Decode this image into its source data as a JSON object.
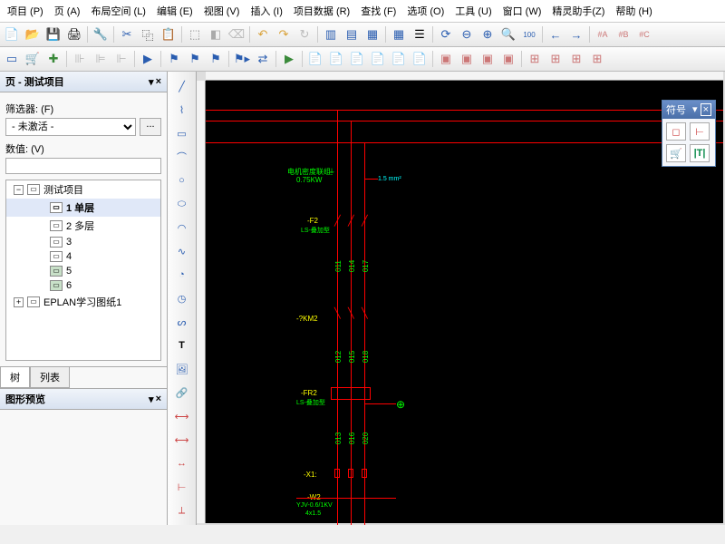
{
  "menu": [
    "项目 (P)",
    "页 (A)",
    "布局空间 (L)",
    "编辑 (E)",
    "视图 (V)",
    "插入 (I)",
    "项目数据 (R)",
    "查找 (F)",
    "选项 (O)",
    "工具 (U)",
    "窗口 (W)",
    "精灵助手(Z)",
    "帮助 (H)"
  ],
  "sidebar": {
    "title": "页 - 测试项目",
    "filter_label": "筛选器: (F)",
    "filter_value": "- 未激活 -",
    "dots": "...",
    "value_label": "数值: (V)",
    "tree": {
      "root": "测试项目",
      "items": [
        {
          "label": "1 单层",
          "sel": true
        },
        {
          "label": "2 多层"
        },
        {
          "label": "3"
        },
        {
          "label": "4"
        },
        {
          "label": "5"
        },
        {
          "label": "6"
        }
      ],
      "root2": "EPLAN学习图纸1"
    },
    "tabs": [
      "树",
      "列表"
    ],
    "preview_title": "图形预览"
  },
  "floating": {
    "title": "符号"
  },
  "canvas": {
    "labels": {
      "motor": "电机密度联组",
      "motor_kw": "0.75KW",
      "wiresz": "1.5 mm²",
      "f2": "-F2",
      "f2sub": "LS-叠加型",
      "km": "-?KM2",
      "fr2": "-FR2",
      "fr2sub": "LS-叠加型",
      "k1": "-X1:",
      "w2": "-W2",
      "w2sub": "YJV-0.6/1KV",
      "w2sz": "4x1.5"
    }
  }
}
